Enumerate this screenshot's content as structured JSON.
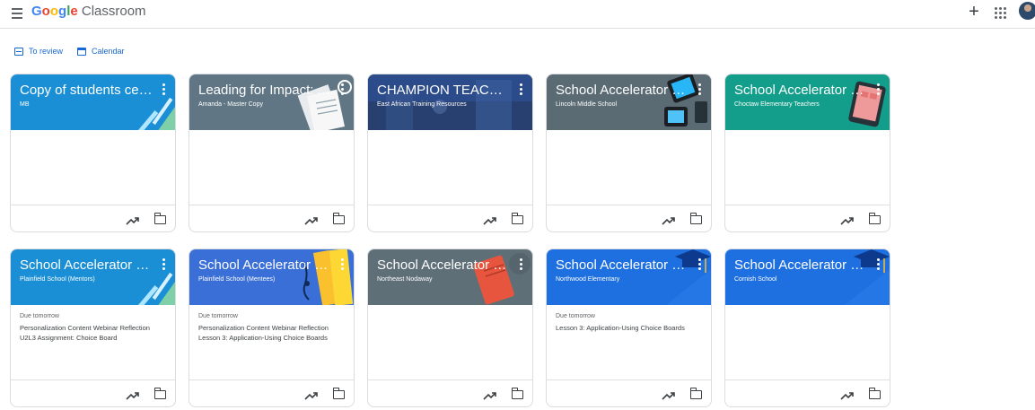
{
  "app": {
    "brand_google": "Google",
    "brand_suffix": " Classroom",
    "plus_label": "+"
  },
  "nav": {
    "to_review": "To review",
    "calendar": "Calendar"
  },
  "colors": {
    "google_blue": "#4285f4",
    "google_red": "#ea4335",
    "google_yellow": "#fbbc04",
    "google_green": "#34a853",
    "link_blue": "#1967d2"
  },
  "classes": [
    {
      "title": "Copy of students cen...",
      "section": "MB",
      "theme_color": "#1a8fd6",
      "decoration": "pencil-ruler",
      "due_label": "",
      "assignments": []
    },
    {
      "title": "Leading for Impact: A...",
      "section": "Amanda - Master Copy",
      "theme_color": "#607684",
      "decoration": "notebook",
      "due_label": "",
      "assignments": []
    },
    {
      "title": "CHAMPION TEACHE...",
      "section": "East African Training Resources",
      "theme_color": "#2c4b8a",
      "decoration": "photo",
      "due_label": "",
      "assignments": []
    },
    {
      "title": "School Accelerator P...",
      "section": "Lincoln Middle School",
      "theme_color": "#5a6b73",
      "decoration": "devices",
      "due_label": "",
      "assignments": []
    },
    {
      "title": "School Accelerator P...",
      "section": "Choctaw Elementary Teachers",
      "theme_color": "#129e8a",
      "decoration": "tablet",
      "due_label": "",
      "assignments": []
    },
    {
      "title": "School Accelerator P...",
      "section": "Plainfield School (Mentors)",
      "theme_color": "#1a8fd6",
      "decoration": "pencil-ruler",
      "due_label": "Due tomorrow",
      "assignments": [
        "Personalization Content Webinar Reflection",
        "U2L3 Assignment: Choice Board"
      ]
    },
    {
      "title": "School Accelerator P...",
      "section": "Plainfield School (Mentees)",
      "theme_color": "#3b6fd8",
      "decoration": "books",
      "due_label": "Due tomorrow",
      "assignments": [
        "Personalization Content Webinar Reflection",
        "Lesson 3: Application-Using Choice Boards"
      ]
    },
    {
      "title": "School Accelerator P...",
      "section": "Northeast Nodaway",
      "theme_color": "#5f6f78",
      "decoration": "red-book",
      "due_label": "",
      "assignments": []
    },
    {
      "title": "School Accelerator P...",
      "section": "Northwood Elementary",
      "theme_color": "#1e6fe0",
      "decoration": "grad-cap",
      "due_label": "Due tomorrow",
      "assignments": [
        "Lesson 3: Application-Using Choice Boards"
      ]
    },
    {
      "title": "School Accelerator P...",
      "section": "Cornish School",
      "theme_color": "#1e6fe0",
      "decoration": "grad-cap",
      "due_label": "",
      "assignments": []
    }
  ]
}
